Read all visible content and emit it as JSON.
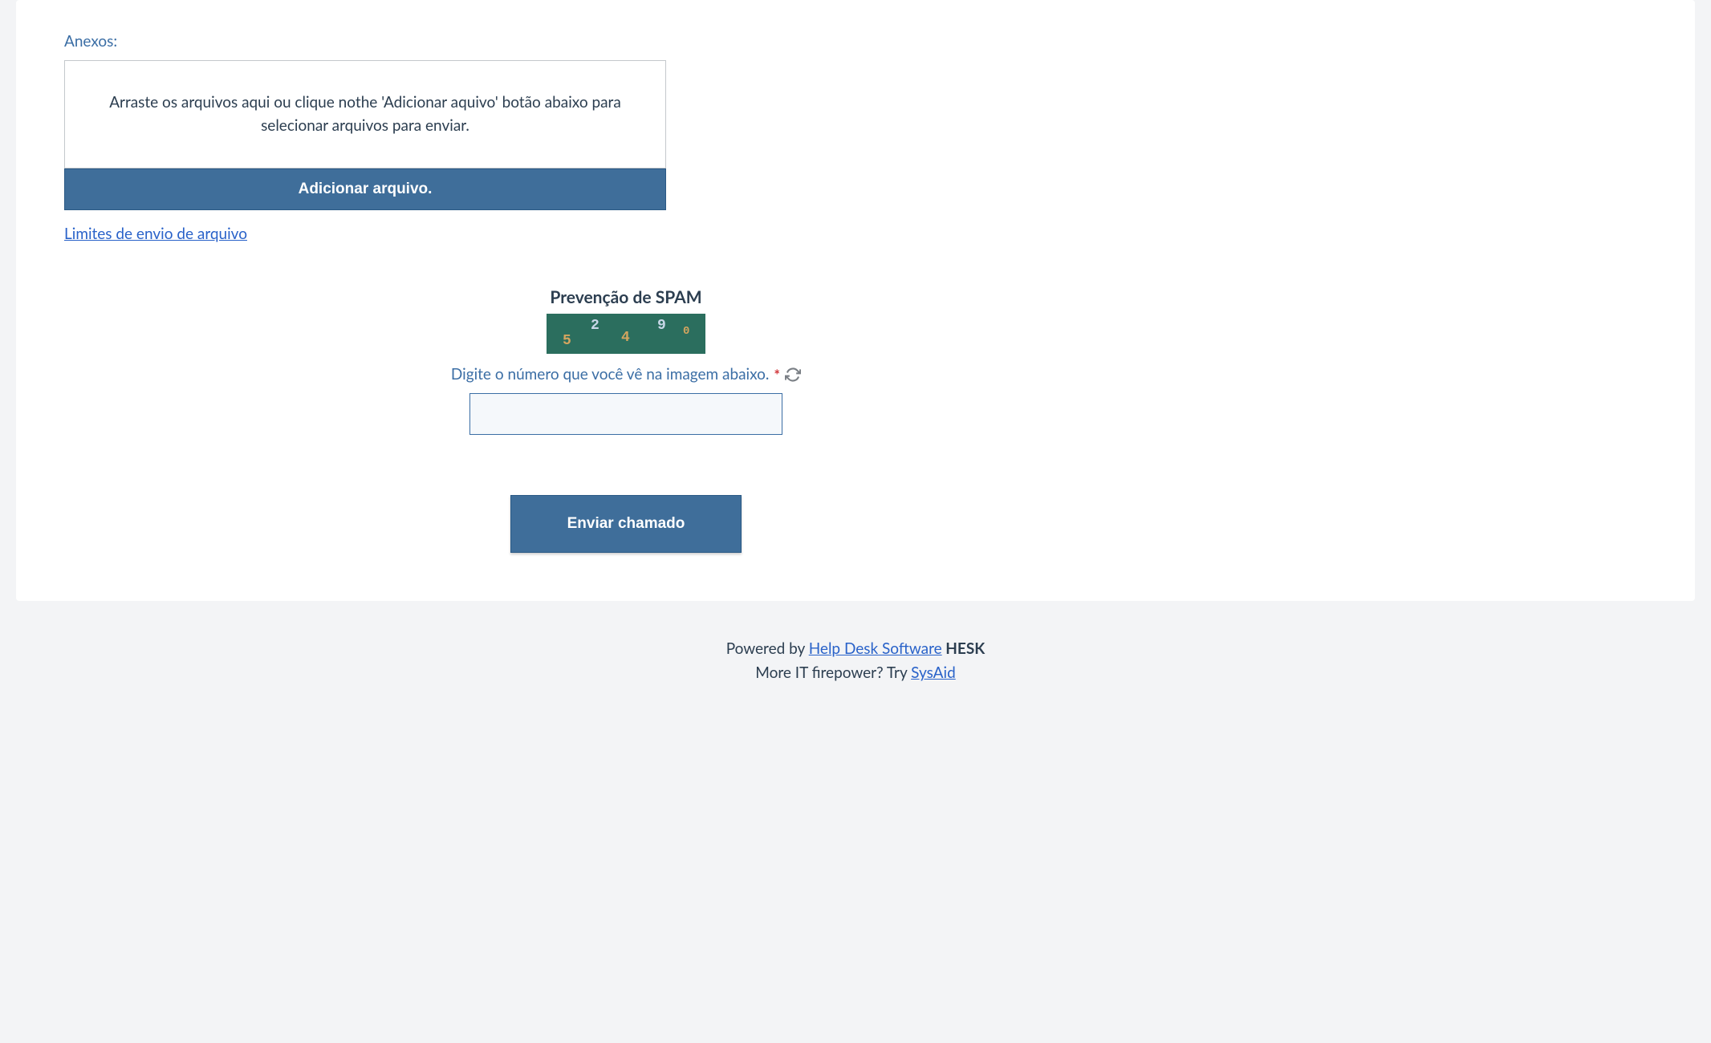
{
  "attachments": {
    "label": "Anexos:",
    "dropzone_text": "Arraste os arquivos aqui ou clique nothe 'Adicionar aquivo' botão abaixo para selecionar arquivos para enviar.",
    "add_file_label": "Adicionar arquivo.",
    "limits_link": "Limites de envio de arquivo"
  },
  "spam": {
    "title": "Prevenção de SPAM",
    "captcha_digits": [
      "5",
      "2",
      "4",
      "9",
      "0"
    ],
    "instruction": "Digite o número que você vê na imagem abaixo.",
    "required_marker": "*"
  },
  "submit": {
    "label": "Enviar chamado"
  },
  "footer": {
    "powered_by_prefix": "Powered by ",
    "helpdesk_link": "Help Desk Software",
    "hesk_label": " HESK",
    "more_prefix": "More IT firepower? Try ",
    "sysaid_link": "SysAid"
  }
}
